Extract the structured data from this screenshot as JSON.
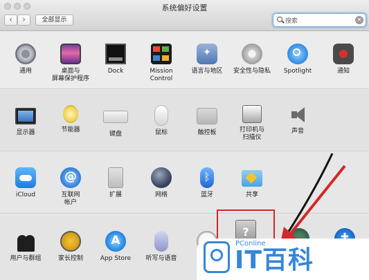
{
  "window": {
    "title": "系统偏好设置",
    "nav_back": "‹",
    "nav_forward": "›",
    "show_all": "全部显示",
    "search_placeholder": "搜索",
    "search_clear": "×"
  },
  "rows": [
    {
      "items": [
        {
          "name": "general",
          "label": "通用",
          "icon": "gear-icon"
        },
        {
          "name": "desktop-screensaver",
          "label": "桌面与\n屏幕保护程序",
          "icon": "desktop-icon"
        },
        {
          "name": "dock",
          "label": "Dock",
          "icon": "dock-icon"
        },
        {
          "name": "mission-control",
          "label": "Mission\nControl",
          "icon": "mission-control-icon"
        },
        {
          "name": "language-region",
          "label": "语言与地区",
          "icon": "globe-flag-icon"
        },
        {
          "name": "security-privacy",
          "label": "安全性与隐私",
          "icon": "house-lock-icon"
        },
        {
          "name": "spotlight",
          "label": "Spotlight",
          "icon": "spotlight-icon"
        },
        {
          "name": "notifications",
          "label": "通知",
          "icon": "notifications-icon"
        }
      ]
    },
    {
      "items": [
        {
          "name": "displays",
          "label": "显示器",
          "icon": "display-icon"
        },
        {
          "name": "energy-saver",
          "label": "节能器",
          "icon": "lightbulb-icon"
        },
        {
          "name": "keyboard",
          "label": "键盘",
          "icon": "keyboard-icon"
        },
        {
          "name": "mouse",
          "label": "鼠标",
          "icon": "mouse-icon"
        },
        {
          "name": "trackpad",
          "label": "触控板",
          "icon": "trackpad-icon"
        },
        {
          "name": "printers-scanners",
          "label": "打印机与\n扫描仪",
          "icon": "printer-icon"
        },
        {
          "name": "sound",
          "label": "声音",
          "icon": "speaker-icon"
        }
      ]
    },
    {
      "items": [
        {
          "name": "icloud",
          "label": "iCloud",
          "icon": "icloud-icon"
        },
        {
          "name": "internet-accounts",
          "label": "互联网\n帐户",
          "icon": "at-sign-icon"
        },
        {
          "name": "extensions",
          "label": "扩展",
          "icon": "puzzle-icon"
        },
        {
          "name": "network",
          "label": "网络",
          "icon": "network-globe-icon"
        },
        {
          "name": "bluetooth",
          "label": "蓝牙",
          "icon": "bluetooth-icon"
        },
        {
          "name": "sharing",
          "label": "共享",
          "icon": "sharing-folder-icon"
        }
      ]
    },
    {
      "items": [
        {
          "name": "users-groups",
          "label": "用户与群组",
          "icon": "users-icon"
        },
        {
          "name": "parental-controls",
          "label": "家长控制",
          "icon": "parental-controls-icon"
        },
        {
          "name": "app-store",
          "label": "App Store",
          "icon": "app-store-icon"
        },
        {
          "name": "dictation-speech",
          "label": "听写与语音",
          "icon": "microphone-icon"
        },
        {
          "name": "date-time",
          "label": "",
          "icon": "clock-icon"
        },
        {
          "name": "startup-disk",
          "label": "",
          "icon": "startup-disk-icon"
        },
        {
          "name": "time-machine",
          "label": "",
          "icon": "time-machine-icon"
        },
        {
          "name": "accessibility",
          "label": "",
          "icon": "accessibility-icon"
        }
      ]
    }
  ],
  "watermark": {
    "small_text": "PConline",
    "big_text": "IT百科"
  },
  "colors": {
    "highlight": "#d4262d",
    "watermark_blue": "#3586da"
  }
}
